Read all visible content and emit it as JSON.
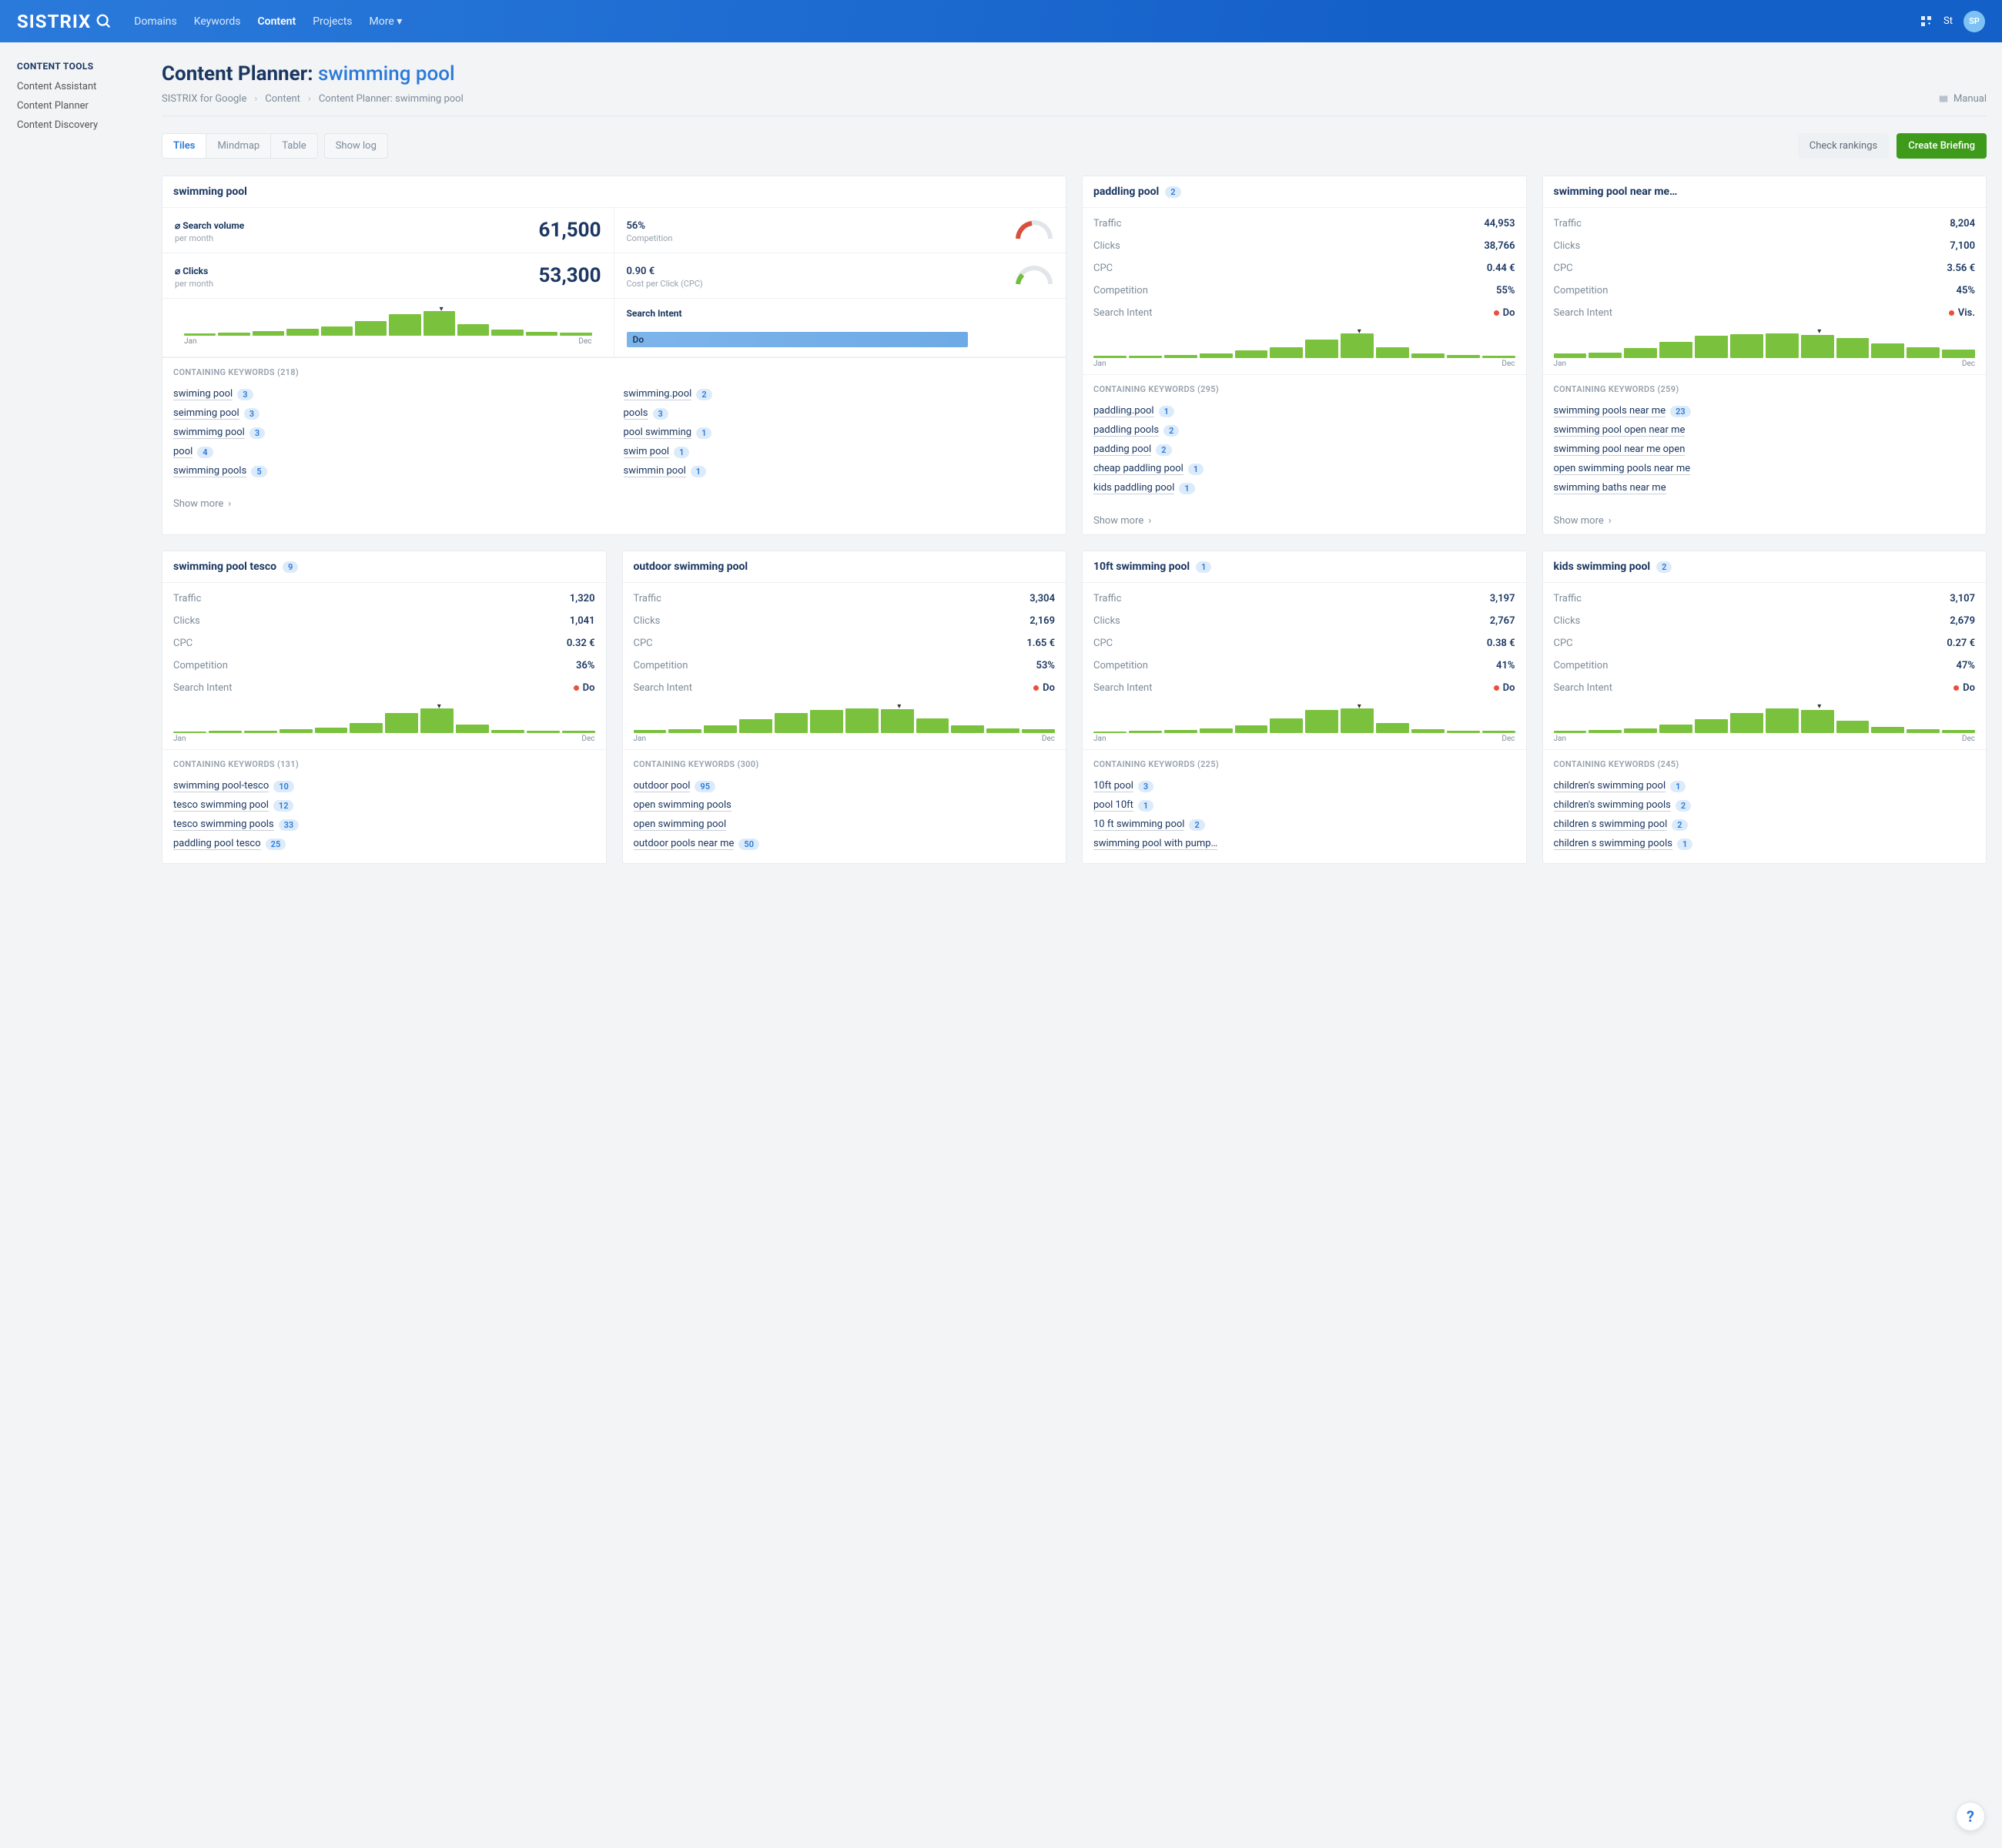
{
  "brand": "SISTRIX",
  "nav": {
    "domains": "Domains",
    "keywords": "Keywords",
    "content": "Content",
    "projects": "Projects",
    "more": "More"
  },
  "topbar": {
    "short": "St",
    "avatar": "SP"
  },
  "sidebar": {
    "title": "CONTENT TOOLS",
    "items": [
      "Content Assistant",
      "Content Planner",
      "Content Discovery"
    ]
  },
  "page": {
    "title_prefix": "Content Planner: ",
    "keyword": "swimming pool"
  },
  "crumbs": {
    "a": "SISTRIX for Google",
    "b": "Content",
    "c": "Content Planner: swimming pool",
    "manual": "Manual"
  },
  "tabs": {
    "tiles": "Tiles",
    "mindmap": "Mindmap",
    "table": "Table",
    "showlog": "Show log"
  },
  "actions": {
    "check": "Check rankings",
    "brief": "Create Briefing"
  },
  "show_more": "Show more",
  "chart": {
    "jan": "Jan",
    "dec": "Dec"
  },
  "main_tile": {
    "title": "swimming pool",
    "search_volume_label": "⌀ Search volume",
    "per_month": "per month",
    "search_volume": "61,500",
    "clicks_label": "⌀ Clicks",
    "clicks": "53,300",
    "competition_pct": "56%",
    "competition_label": "Competition",
    "cpc": "0.90 €",
    "cpc_label": "Cost per Click (CPC)",
    "intent_label": "Search Intent",
    "intent": "Do",
    "kw_head": "CONTAINING KEYWORDS (218)",
    "kw_left": [
      [
        "swiming pool",
        "3"
      ],
      [
        "seimming pool",
        "3"
      ],
      [
        "swimmimg pool",
        "3"
      ],
      [
        "pool",
        "4"
      ],
      [
        "swimming pools",
        "5"
      ]
    ],
    "kw_right": [
      [
        "swimming.pool",
        "2"
      ],
      [
        "pools",
        "3"
      ],
      [
        "pool swimming",
        "1"
      ],
      [
        "swim pool",
        "1"
      ],
      [
        "swimmin pool",
        "1"
      ]
    ]
  },
  "chart_data": [
    {
      "type": "bar",
      "title": "swimming pool search volume trend",
      "categories": [
        "Jan",
        "Feb",
        "Mar",
        "Apr",
        "May",
        "Jun",
        "Jul",
        "Aug",
        "Sep",
        "Oct",
        "Nov",
        "Dec"
      ],
      "values": [
        10,
        12,
        18,
        28,
        38,
        58,
        88,
        100,
        48,
        24,
        16,
        14
      ],
      "xlabel": "",
      "ylabel": "",
      "ylim": [
        0,
        100
      ]
    }
  ],
  "tiles": [
    {
      "title": "paddling pool",
      "badge": "2",
      "traffic": "44,953",
      "clicks": "38,766",
      "cpc": "0.44 €",
      "competition": "55%",
      "intent": "Do",
      "trend": [
        8,
        10,
        12,
        18,
        30,
        45,
        75,
        100,
        45,
        18,
        12,
        10
      ],
      "kw_head": "CONTAINING KEYWORDS (295)",
      "kws": [
        [
          "paddling.pool",
          "1"
        ],
        [
          "paddling pools",
          "2"
        ],
        [
          "padding pool",
          "2"
        ],
        [
          "cheap paddling pool",
          "1"
        ],
        [
          "kids paddling pool",
          "1"
        ]
      ]
    },
    {
      "title": "swimming pool near me…",
      "badge": "",
      "traffic": "8,204",
      "clicks": "7,100",
      "cpc": "3.56 €",
      "competition": "45%",
      "intent": "Vis.",
      "trend": [
        18,
        22,
        40,
        65,
        90,
        98,
        100,
        95,
        80,
        60,
        45,
        35
      ],
      "kw_head": "CONTAINING KEYWORDS (259)",
      "kws": [
        [
          "swimming pools near me",
          "23"
        ],
        [
          "swimming pool open near me",
          ""
        ],
        [
          "swimming pool near me open",
          ""
        ],
        [
          "open swimming pools near me",
          ""
        ],
        [
          "swimming baths near me",
          ""
        ]
      ]
    },
    {
      "title": "swimming pool tesco",
      "badge": "9",
      "traffic": "1,320",
      "clicks": "1,041",
      "cpc": "0.32 €",
      "competition": "36%",
      "intent": "Do",
      "trend": [
        6,
        8,
        10,
        15,
        22,
        40,
        80,
        100,
        35,
        14,
        10,
        8
      ],
      "kw_head": "CONTAINING KEYWORDS (131)",
      "kws": [
        [
          "swimming pool-tesco",
          "10"
        ],
        [
          "tesco swimming pool",
          "12"
        ],
        [
          "tesco swimming pools",
          "33"
        ],
        [
          "paddling pool tesco",
          "25"
        ]
      ]
    },
    {
      "title": "outdoor swimming pool",
      "badge": "",
      "traffic": "3,304",
      "clicks": "2,169",
      "cpc": "1.65 €",
      "competition": "53%",
      "intent": "Do",
      "trend": [
        14,
        16,
        30,
        55,
        80,
        95,
        100,
        98,
        60,
        30,
        20,
        16
      ],
      "kw_head": "CONTAINING KEYWORDS (300)",
      "kws": [
        [
          "outdoor pool",
          "95"
        ],
        [
          "open swimming pools",
          ""
        ],
        [
          "open swimming pool",
          ""
        ],
        [
          "outdoor pools near me",
          "50"
        ]
      ]
    },
    {
      "title": "10ft swimming pool",
      "badge": "1",
      "traffic": "3,197",
      "clicks": "2,767",
      "cpc": "0.38 €",
      "competition": "41%",
      "intent": "Do",
      "trend": [
        6,
        8,
        12,
        18,
        32,
        60,
        95,
        100,
        40,
        15,
        10,
        8
      ],
      "kw_head": "CONTAINING KEYWORDS (225)",
      "kws": [
        [
          "10ft pool",
          "3"
        ],
        [
          "pool 10ft",
          "1"
        ],
        [
          "10 ft swimming pool",
          "2"
        ],
        [
          "swimming pool with pump…",
          ""
        ]
      ]
    },
    {
      "title": "kids swimming pool",
      "badge": "2",
      "traffic": "3,107",
      "clicks": "2,679",
      "cpc": "0.27 €",
      "competition": "47%",
      "intent": "Do",
      "trend": [
        10,
        12,
        20,
        35,
        55,
        80,
        100,
        95,
        50,
        25,
        16,
        12
      ],
      "kw_head": "CONTAINING KEYWORDS (245)",
      "kws": [
        [
          "children's swimming pool",
          "1"
        ],
        [
          "children's swimming pools",
          "2"
        ],
        [
          "children s swimming pool",
          "2"
        ],
        [
          "children s swimming pools",
          "1"
        ]
      ]
    }
  ],
  "labels": {
    "traffic": "Traffic",
    "clicks": "Clicks",
    "cpc": "CPC",
    "competition": "Competition",
    "intent": "Search Intent"
  }
}
